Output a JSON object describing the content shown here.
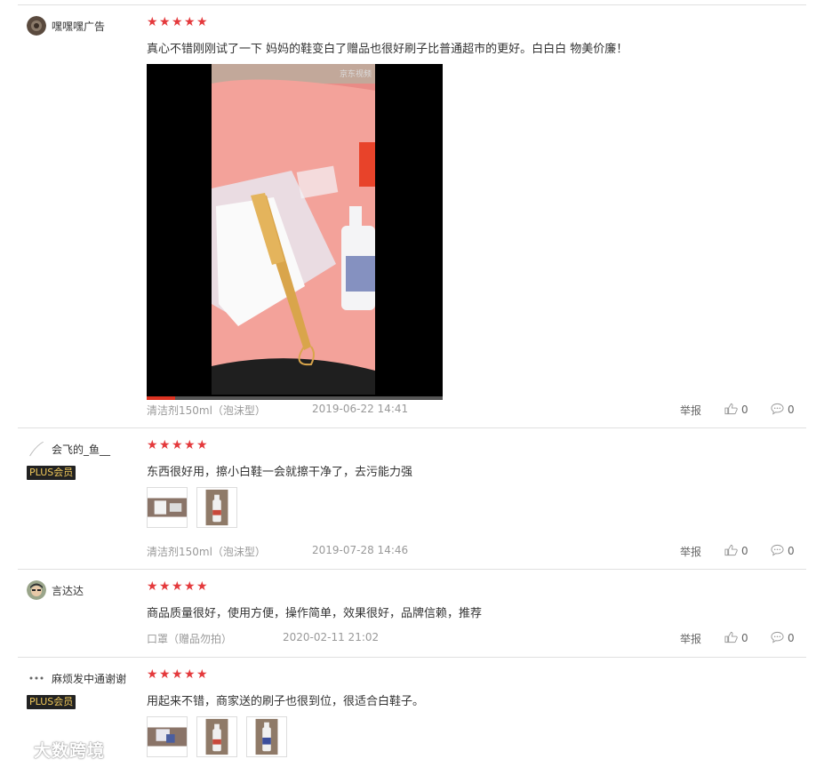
{
  "reviews": [
    {
      "user": "嘿嘿嘿广告",
      "plus": "",
      "rating": 5,
      "text": "真心不错刚刚试了一下 妈妈的鞋变白了赠品也很好刷子比普通超市的更好。白白白 物美价廉！",
      "variant": "清洁剂150ml（泡沫型）",
      "date": "2019-06-22 14:41",
      "report": "举报",
      "likes": "0",
      "comments": "0",
      "video_watermark": "京东视频"
    },
    {
      "user": "会飞的_鱼__",
      "plus": "PLUS会员",
      "rating": 5,
      "text": "东西很好用，擦小白鞋一会就擦干净了，去污能力强",
      "variant": "清洁剂150ml（泡沫型）",
      "date": "2019-07-28 14:46",
      "report": "举报",
      "likes": "0",
      "comments": "0"
    },
    {
      "user": "言达达",
      "plus": "",
      "rating": 5,
      "text": "商品质量很好，使用方便，操作简单，效果很好，品牌信赖，推荐",
      "variant": "口罩（赠品勿拍）",
      "date": "2020-02-11 21:02",
      "report": "举报",
      "likes": "0",
      "comments": "0"
    },
    {
      "user": "麻烦发中通谢谢",
      "plus": "PLUS会员",
      "rating": 5,
      "text": "用起来不错，商家送的刷子也很到位，很适合白鞋子。"
    }
  ],
  "watermark": "大数跨境",
  "colors": {
    "star": "#e4393c",
    "meta": "#999999",
    "plus_bg": "#222222",
    "plus_text": "#f0c85a"
  }
}
